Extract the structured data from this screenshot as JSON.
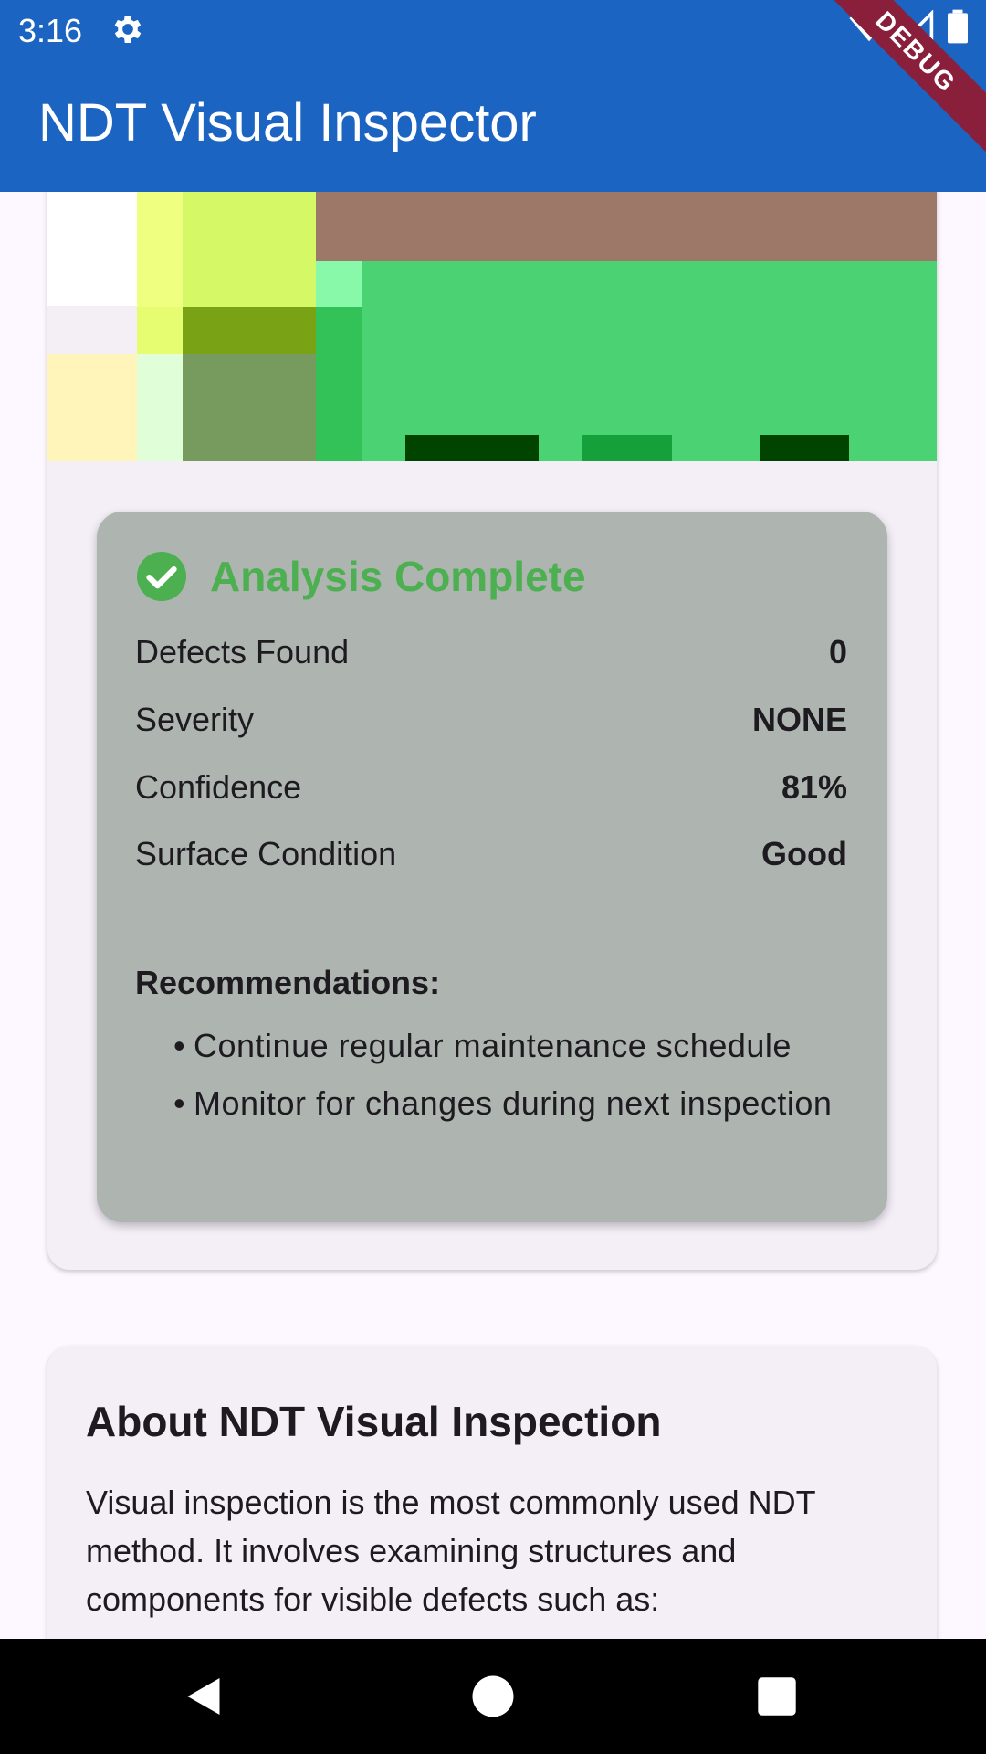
{
  "status_bar": {
    "time": "3:16"
  },
  "app_bar": {
    "title": "NDT Visual Inspector",
    "debug_label": "DEBUG"
  },
  "analysis": {
    "title": "Analysis Complete",
    "stats": [
      {
        "label": "Defects Found",
        "value": "0"
      },
      {
        "label": "Severity",
        "value": "NONE"
      },
      {
        "label": "Confidence",
        "value": "81%"
      },
      {
        "label": "Surface Condition",
        "value": "Good"
      }
    ],
    "recommendations_title": "Recommendations:",
    "recommendations": [
      "Continue regular maintenance schedule",
      "Monitor for changes during next inspection"
    ],
    "bullet": "•"
  },
  "about": {
    "title": "About NDT Visual Inspection",
    "body": "Visual inspection is the most commonly used NDT method. It involves examining structures and components for visible defects such as:"
  },
  "colors": {
    "app_bar": "#1c64c2",
    "success": "#4caf50",
    "analysis_bg": "#aeb4b0",
    "card_bg": "#f4eff7"
  }
}
